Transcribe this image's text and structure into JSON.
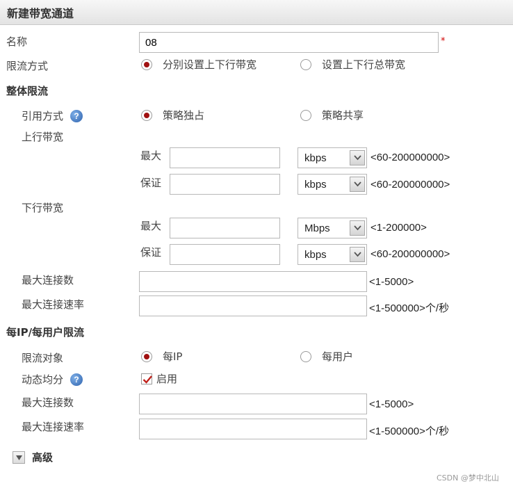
{
  "header": {
    "title": "新建带宽通道"
  },
  "name_field": {
    "label": "名称",
    "value": "08",
    "required_mark": "*"
  },
  "limit_mode": {
    "label": "限流方式",
    "options": [
      {
        "label": "分别设置上下行带宽",
        "checked": true
      },
      {
        "label": "设置上下行总带宽",
        "checked": false
      }
    ]
  },
  "overall_limit": {
    "title": "整体限流",
    "reference_mode": {
      "label": "引用方式",
      "help_icon": "?",
      "options": [
        {
          "label": "策略独占",
          "checked": true
        },
        {
          "label": "策略共享",
          "checked": false
        }
      ]
    },
    "upstream": {
      "label": "上行带宽",
      "max": {
        "label": "最大",
        "value": "",
        "unit": "kbps",
        "range": "<60-200000000>"
      },
      "guarantee": {
        "label": "保证",
        "value": "",
        "unit": "kbps",
        "range": "<60-200000000>"
      }
    },
    "downstream": {
      "label": "下行带宽",
      "max": {
        "label": "最大",
        "value": "",
        "unit": "Mbps",
        "range": "<1-200000>"
      },
      "guarantee": {
        "label": "保证",
        "value": "",
        "unit": "kbps",
        "range": "<60-200000000>"
      }
    },
    "max_connections": {
      "label": "最大连接数",
      "value": "",
      "range": "<1-5000>"
    },
    "max_connection_rate": {
      "label": "最大连接速率",
      "value": "",
      "range": "<1-500000>个/秒"
    }
  },
  "per_limit": {
    "title": "每IP/每用户限流",
    "target": {
      "label": "限流对象",
      "options": [
        {
          "label": "每IP",
          "checked": true
        },
        {
          "label": "每用户",
          "checked": false
        }
      ]
    },
    "dynamic_share": {
      "label": "动态均分",
      "help_icon": "?",
      "checkbox_label": "启用",
      "checked": true
    },
    "max_connections": {
      "label": "最大连接数",
      "value": "",
      "range": "<1-5000>"
    },
    "max_connection_rate": {
      "label": "最大连接速率",
      "value": "",
      "range": "<1-500000>个/秒"
    }
  },
  "advanced": {
    "label": "高级"
  },
  "watermark": "CSDN @梦中北山",
  "icons": {
    "radio": "radio-button",
    "help": "help-icon",
    "dropdown": "chevron-down-icon",
    "check": "check-icon",
    "expand": "triangle-down-icon"
  },
  "colors": {
    "radio_dot": "#a01010",
    "check_mark": "#c0201a",
    "help_icon": "#2e62ad",
    "required": "#d00000"
  }
}
